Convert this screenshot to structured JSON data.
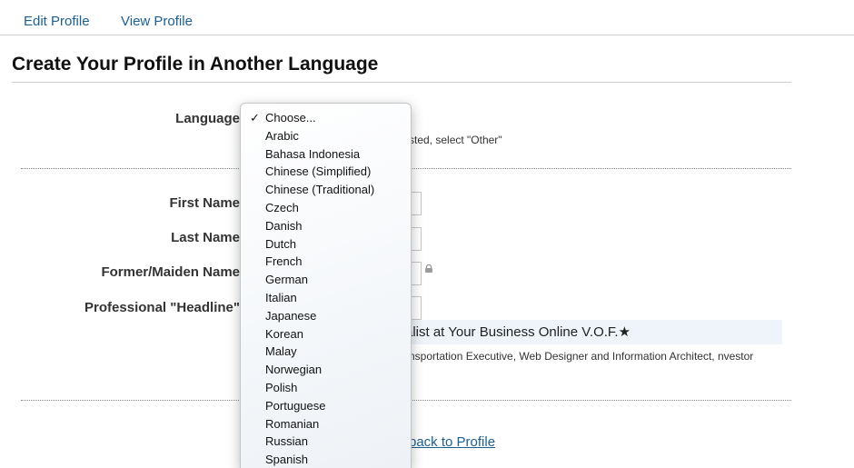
{
  "tabs": {
    "edit_profile": "Edit Profile",
    "view_profile": "View Profile"
  },
  "page": {
    "title": "Create Your Profile in Another Language"
  },
  "form": {
    "language_label": "Language",
    "language_hint": "sted, select \"Other\"",
    "first_name_label": "First Name",
    "last_name_label": "Last Name",
    "former_name_label": "Former/Maiden Name",
    "headline_label": "Professional \"Headline\"",
    "current_headline": "alist at Your Business Online V.O.F.★",
    "headline_suggestion": "nsportation Executive, Web Designer and Information Architect, nvestor",
    "back_link": "back to Profile"
  },
  "language_menu": {
    "selected_index": 0,
    "check_glyph": "✓",
    "options": [
      "Choose...",
      "Arabic",
      "Bahasa Indonesia",
      "Chinese (Simplified)",
      "Chinese (Traditional)",
      "Czech",
      "Danish",
      "Dutch",
      "French",
      "German",
      "Italian",
      "Japanese",
      "Korean",
      "Malay",
      "Norwegian",
      "Polish",
      "Portuguese",
      "Romanian",
      "Russian",
      "Spanish"
    ]
  },
  "icons": {
    "lock": "lock-icon"
  },
  "colors": {
    "link": "#1b5f93",
    "highlight_bg": "#eef4f9"
  }
}
